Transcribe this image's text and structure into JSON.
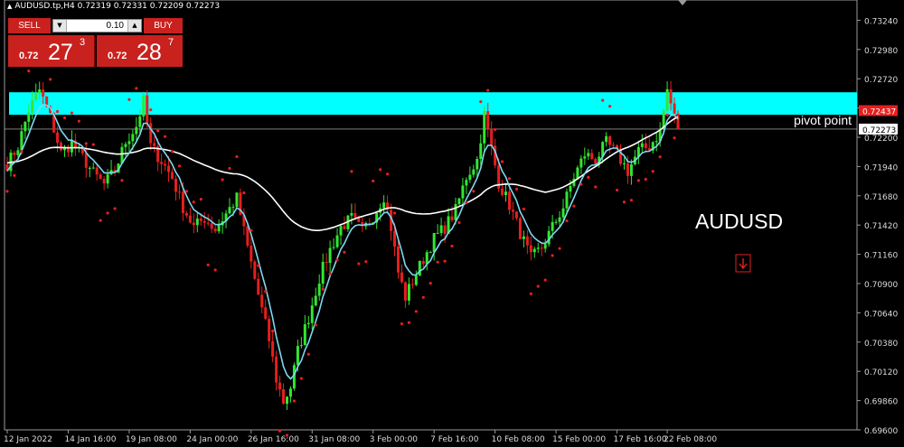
{
  "symbol_header": "AUDUSD.tp,H4  0.72319 0.72331 0.72209 0.72273",
  "trade_panel": {
    "sell_label": "SELL",
    "buy_label": "BUY",
    "lot_value": "0.10",
    "sell_price": {
      "small": "0.72",
      "big": "27",
      "sup": "3"
    },
    "buy_price": {
      "small": "0.72",
      "big": "28",
      "sup": "7"
    }
  },
  "labels": {
    "pivot": "pivot point",
    "symbol": "AUDUSD"
  },
  "colors": {
    "background": "#000000",
    "bull": "#32e632",
    "bear": "#e61e1e",
    "sar": "#e61e1e",
    "ma_fast": "#7fd8f0",
    "ma_slow": "#ffffff",
    "zone": "#00ffff",
    "panel_red": "#c9211e"
  },
  "chart_data": {
    "type": "candlestick",
    "symbol": "AUDUSD.tp",
    "timeframe": "H4",
    "ohlc_current": {
      "open": 0.72319,
      "high": 0.72331,
      "low": 0.72209,
      "close": 0.72273
    },
    "ylim": [
      0.696,
      0.7342
    ],
    "y_ticks": [
      "0.73240",
      "0.72980",
      "0.72720",
      "0.72460",
      "0.72200",
      "0.71940",
      "0.71680",
      "0.71420",
      "0.71160",
      "0.70900",
      "0.70640",
      "0.70380",
      "0.70120",
      "0.69860",
      "0.69600"
    ],
    "x_ticks": [
      "12 Jan 2022",
      "14 Jan 16:00",
      "19 Jan 08:00",
      "24 Jan 00:00",
      "26 Jan 16:00",
      "31 Jan 08:00",
      "3 Feb 00:00",
      "7 Feb 16:00",
      "10 Feb 08:00",
      "15 Feb 00:00",
      "17 Feb 16:00",
      "22 Feb 08:00"
    ],
    "price_markers": [
      {
        "value": 0.72437,
        "label": "0.72437",
        "color": "#e61e1e"
      },
      {
        "value": 0.72273,
        "label": "0.72273",
        "color": "#ffffff"
      }
    ],
    "resistance_zone": {
      "low": 0.724,
      "high": 0.726,
      "color": "#00ffff"
    },
    "pivot_point": 0.72273,
    "close_path": [
      [
        0,
        0.7196
      ],
      [
        3,
        0.7212
      ],
      [
        6,
        0.7244
      ],
      [
        9,
        0.7262
      ],
      [
        12,
        0.7238
      ],
      [
        15,
        0.7206
      ],
      [
        18,
        0.7215
      ],
      [
        21,
        0.7202
      ],
      [
        24,
        0.7188
      ],
      [
        27,
        0.7178
      ],
      [
        30,
        0.719
      ],
      [
        33,
        0.7216
      ],
      [
        36,
        0.723
      ],
      [
        38,
        0.7252
      ],
      [
        40,
        0.7212
      ],
      [
        43,
        0.7199
      ],
      [
        46,
        0.7184
      ],
      [
        49,
        0.7158
      ],
      [
        52,
        0.714
      ],
      [
        55,
        0.7148
      ],
      [
        58,
        0.7138
      ],
      [
        61,
        0.7152
      ],
      [
        64,
        0.7166
      ],
      [
        67,
        0.7122
      ],
      [
        70,
        0.708
      ],
      [
        73,
        0.704
      ],
      [
        75,
        0.7005
      ],
      [
        77,
        0.6985
      ],
      [
        79,
        0.6998
      ],
      [
        81,
        0.703
      ],
      [
        84,
        0.706
      ],
      [
        87,
        0.7095
      ],
      [
        90,
        0.712
      ],
      [
        93,
        0.714
      ],
      [
        96,
        0.7148
      ],
      [
        99,
        0.7136
      ],
      [
        102,
        0.715
      ],
      [
        105,
        0.7168
      ],
      [
        107,
        0.714
      ],
      [
        109,
        0.71
      ],
      [
        111,
        0.7078
      ],
      [
        113,
        0.7092
      ],
      [
        116,
        0.7112
      ],
      [
        119,
        0.713
      ],
      [
        122,
        0.714
      ],
      [
        125,
        0.7155
      ],
      [
        128,
        0.7185
      ],
      [
        131,
        0.72
      ],
      [
        133,
        0.724
      ],
      [
        135,
        0.721
      ],
      [
        137,
        0.718
      ],
      [
        140,
        0.716
      ],
      [
        143,
        0.7135
      ],
      [
        146,
        0.7112
      ],
      [
        149,
        0.7122
      ],
      [
        152,
        0.714
      ],
      [
        155,
        0.7158
      ],
      [
        158,
        0.7185
      ],
      [
        161,
        0.7205
      ],
      [
        164,
        0.72
      ],
      [
        167,
        0.7215
      ],
      [
        170,
        0.7205
      ],
      [
        173,
        0.719
      ],
      [
        176,
        0.7208
      ],
      [
        179,
        0.7212
      ],
      [
        182,
        0.7225
      ],
      [
        184,
        0.7262
      ],
      [
        185,
        0.725
      ],
      [
        186,
        0.7238
      ],
      [
        187,
        0.72273
      ]
    ],
    "series": [
      {
        "name": "",
        "kind": "candles"
      },
      {
        "name": "",
        "kind": "fast_ma"
      },
      {
        "name": "",
        "kind": "slow_ma"
      },
      {
        "name": "",
        "kind": "parabolic_sar"
      }
    ]
  }
}
